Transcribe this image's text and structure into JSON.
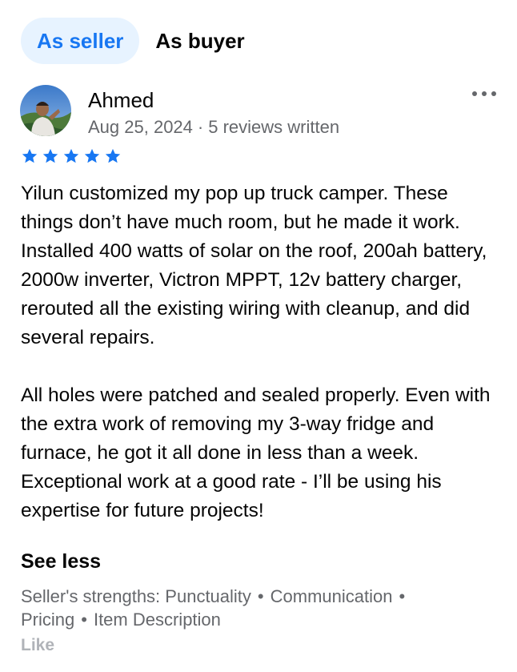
{
  "tabs": [
    {
      "label": "As seller",
      "active": true
    },
    {
      "label": "As buyer",
      "active": false
    }
  ],
  "review": {
    "author": "Ahmed",
    "date": "Aug 25, 2024",
    "separator": "·",
    "reviews_count": "5 reviews written",
    "rating": 5,
    "text": "Yilun customized my pop up truck camper. These things don’t have much room, but he made it work. Installed 400 watts of solar on the roof, 200ah battery, 2000w inverter, Victron MPPT, 12v battery charger, rerouted all the existing wiring with cleanup, and did several repairs.\n\nAll holes were patched and sealed properly. Even with the extra work of removing my 3-way fridge and furnace, he got it all done in less than a week. Exceptional work at a good rate - I’ll be using his expertise for future projects!",
    "see_less_label": "See less",
    "strengths_prefix": "Seller's strengths:",
    "strengths": [
      "Punctuality",
      "Communication",
      "Pricing",
      "Item Description"
    ],
    "like_label": "Like"
  },
  "colors": {
    "accent": "#1877f2",
    "active_tab_bg": "#e7f3ff",
    "secondary_text": "#65676b",
    "disabled_text": "#b0b3b8"
  },
  "icons": {
    "more": "more-horizontal-icon",
    "star": "star-icon"
  }
}
